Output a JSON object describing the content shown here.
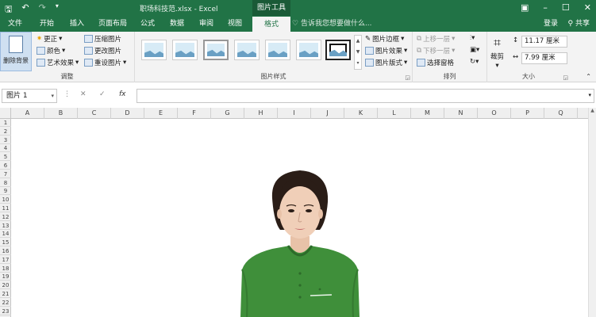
{
  "title_bar": {
    "document_title": "职场科技范.xlsx - Excel",
    "context_tab_group": "图片工具"
  },
  "tabs": [
    {
      "label": "文件"
    },
    {
      "label": "开始"
    },
    {
      "label": "插入"
    },
    {
      "label": "页面布局"
    },
    {
      "label": "公式"
    },
    {
      "label": "数据"
    },
    {
      "label": "审阅"
    },
    {
      "label": "视图"
    },
    {
      "label": "格式",
      "active": true
    }
  ],
  "tell_me": "告诉我您想要做什么...",
  "account": {
    "login": "登录",
    "share": "共享"
  },
  "ribbon": {
    "adjust": {
      "remove_background": "删除背景",
      "corrections": "更正",
      "color": "颜色",
      "artistic_effects": "艺术效果",
      "compress": "压缩图片",
      "change_picture": "更改图片",
      "reset_picture": "重设图片",
      "group_label": "调整"
    },
    "picture_styles": {
      "group_label": "图片样式",
      "border": "图片边框",
      "effects": "图片效果",
      "layout": "图片版式"
    },
    "arrange": {
      "bring_forward": "上移一层",
      "send_backward": "下移一层",
      "selection_pane": "选择窗格",
      "group_label": "排列"
    },
    "size": {
      "crop": "裁剪",
      "height": "11.17 厘米",
      "width": "7.99 厘米",
      "group_label": "大小"
    }
  },
  "formula_bar": {
    "name_box": "图片 1",
    "fx_label": "fx"
  },
  "columns": [
    "A",
    "B",
    "C",
    "D",
    "E",
    "F",
    "G",
    "H",
    "I",
    "J",
    "K",
    "L",
    "M",
    "N",
    "O",
    "P",
    "Q"
  ],
  "rows": [
    "1",
    "2",
    "3",
    "4",
    "5",
    "6",
    "7",
    "8",
    "9",
    "10",
    "11",
    "12",
    "13",
    "14",
    "15",
    "16",
    "17",
    "18",
    "19",
    "20",
    "21",
    "22",
    "23"
  ]
}
